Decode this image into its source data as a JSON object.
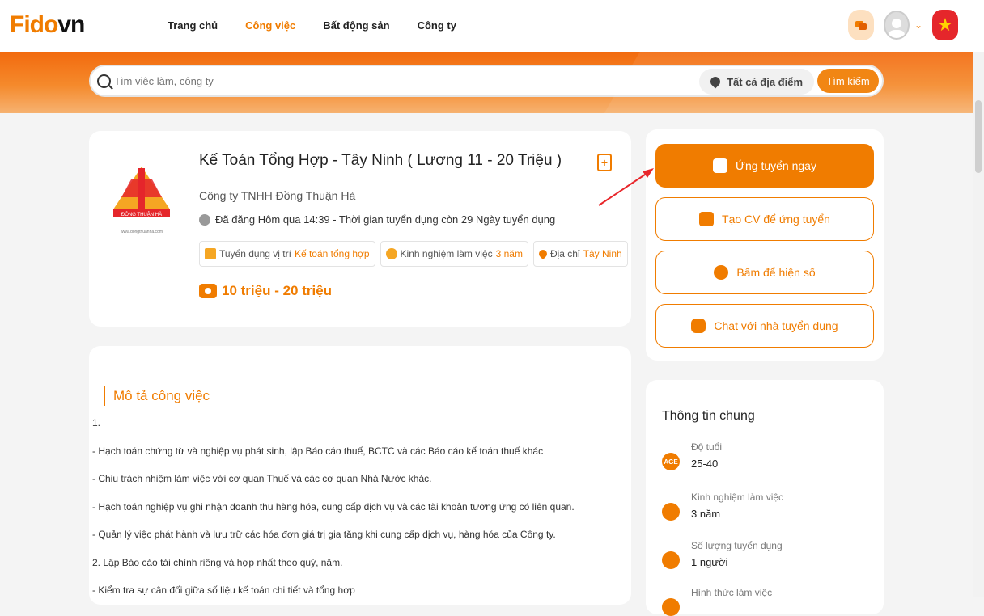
{
  "header": {
    "logo_main": "Fido",
    "logo_suffix": "vn",
    "nav": [
      "Trang chủ",
      "Công việc",
      "Bất động sản",
      "Công ty"
    ],
    "active_nav": "Công việc"
  },
  "search": {
    "placeholder": "Tìm việc làm, công ty",
    "location": "Tất cả địa điểm",
    "button": "Tìm kiếm"
  },
  "job": {
    "title": "Kế Toán Tổng Hợp - Tây Ninh ( Lương 11 - 20 Triệu )",
    "company": "Công ty TNHH Đồng Thuận Hà",
    "company_logo_text": "ĐÔNG THUẬN HÀ",
    "company_logo_url": "www.dongthuanha.com",
    "posted": "Đã đăng Hôm qua 14:39 - Thời gian tuyển dụng còn 29 Ngày tuyển dụng",
    "tags": [
      {
        "label": "Tuyển dụng vị trí",
        "value": "Kế toán tổng hợp"
      },
      {
        "label": "Kinh nghiệm làm việc",
        "value": "3 năm"
      },
      {
        "label": "Địa chỉ",
        "value": "Tây Ninh"
      }
    ],
    "salary": "10 triệu - 20 triệu"
  },
  "actions": {
    "apply_now": "Ứng tuyển ngay",
    "create_cv": "Tạo CV để ứng tuyển",
    "show_phone": "Bấm để hiện số",
    "chat": "Chat với nhà tuyển dụng"
  },
  "description": {
    "heading": "Mô tả công việc",
    "lines": [
      "1.",
      "- Hạch toán chứng từ và nghiệp vụ phát sinh, lập Báo cáo thuế, BCTC và các Báo cáo kế toán thuế khác",
      "- Chịu trách nhiệm làm việc với cơ quan Thuế và các cơ quan Nhà Nước khác.",
      "- Hạch toán nghiệp vụ ghi nhận doanh thu hàng hóa, cung cấp dịch vụ và các tài khoản tương ứng có liên quan.",
      "- Quản lý việc phát hành và lưu trữ các hóa đơn giá trị gia tăng khi cung cấp dịch vụ, hàng hóa của Công ty.",
      "2. Lập Báo cáo tài chính riêng và hợp nhất theo quý, năm.",
      "- Kiểm tra sự cân đối giữa số liệu kế toán chi tiết và tổng hợp"
    ]
  },
  "info": {
    "heading": "Thông tin chung",
    "age_icon_text": "AGE",
    "rows": [
      {
        "label": "Độ tuổi",
        "value": "25-40"
      },
      {
        "label": "Kinh nghiệm làm việc",
        "value": "3 năm"
      },
      {
        "label": "Số lượng tuyển dụng",
        "value": "1 người"
      },
      {
        "label": "Hình thức làm việc",
        "value": ""
      }
    ]
  },
  "colors": {
    "accent": "#f07c00",
    "annotation_arrow": "#e8262b"
  }
}
